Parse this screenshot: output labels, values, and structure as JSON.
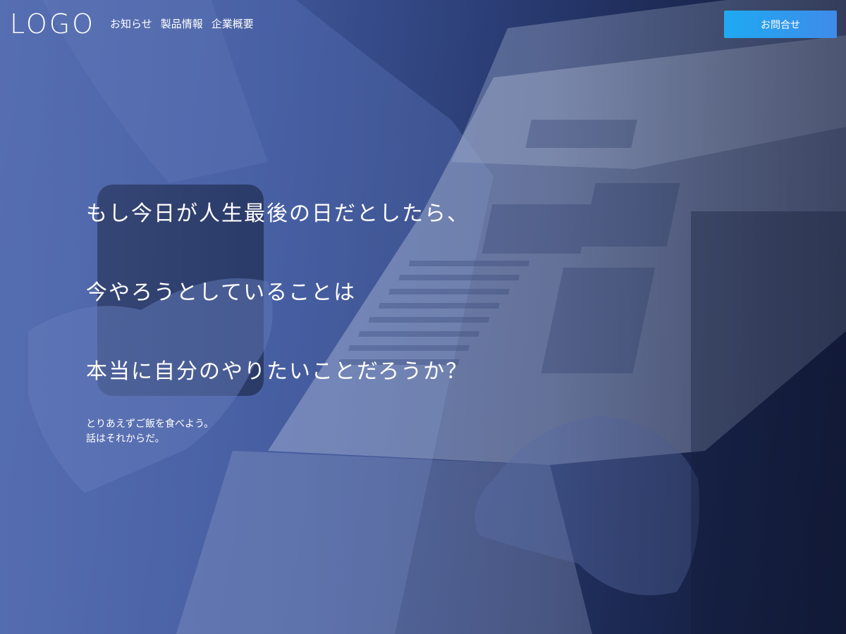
{
  "header": {
    "logo": "LOGO",
    "nav": [
      {
        "label": "お知らせ"
      },
      {
        "label": "製品情報"
      },
      {
        "label": "企業概要"
      }
    ],
    "contact_label": "お問合せ"
  },
  "hero": {
    "lines": [
      "もし今日が人生最後の日だとしたら、",
      "今やろうとしていることは",
      "本当に自分のやりたいことだろうか？"
    ],
    "sub_lines": [
      "とりあえずご飯を食べよう。",
      "話はそれからだ。"
    ]
  },
  "colors": {
    "button_start": "#1eaaf2",
    "button_end": "#3f8bea",
    "background_dark": "#141d3c",
    "background_light": "#4f65a8"
  }
}
